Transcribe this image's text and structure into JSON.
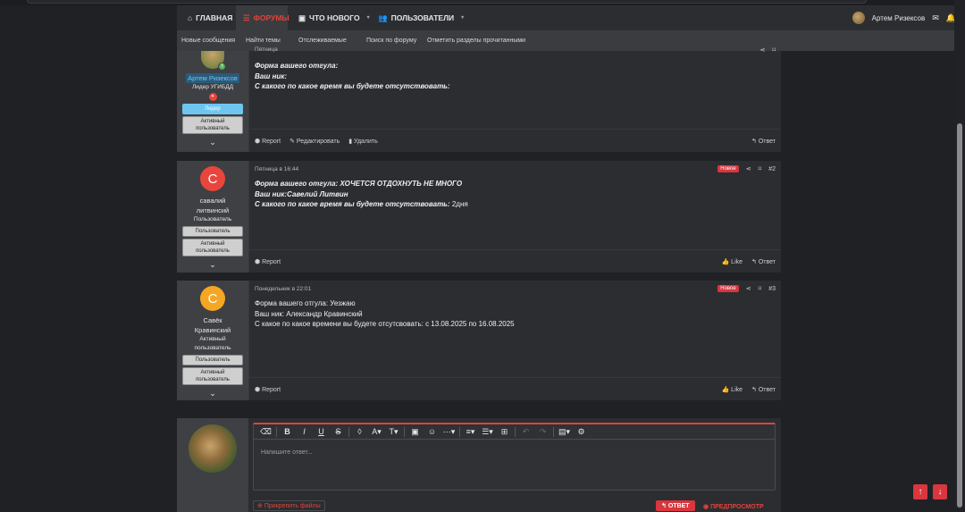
{
  "nav": {
    "items": [
      {
        "label": "ГЛАВНАЯ",
        "icon": "home-icon"
      },
      {
        "label": "ФОРУМЫ",
        "icon": "forum-icon"
      },
      {
        "label": "ЧТО НОВОГО",
        "icon": "news-icon"
      },
      {
        "label": "ПОЛЬЗОВАТЕЛИ",
        "icon": "users-icon"
      }
    ],
    "user_name": "Артем Ризексов",
    "accent_color": "#e0433a"
  },
  "subnav": {
    "items": [
      "Новые сообщения",
      "Найти темы",
      "Отслеживаемые",
      "Поиск по форуму",
      "Отметить разделы прочитанными"
    ]
  },
  "posts": [
    {
      "author": "Артем Ризексов",
      "author_title": "Лидер УГИБДД",
      "badges": [
        "Лидер",
        "Активный пользователь"
      ],
      "date": "Пятница",
      "lines": [
        {
          "label": "Форма вашего отгула:",
          "value": ""
        },
        {
          "label": "Ваш ник:",
          "value": ""
        },
        {
          "label": "С какого по какое время вы будете отсутствовать:",
          "value": ""
        }
      ],
      "footer_left": [
        "Report",
        "Редактировать",
        "Удалить"
      ],
      "footer_right": [
        "Ответ"
      ]
    },
    {
      "author_initial": "C",
      "author": "савалий литвинсий",
      "author_title": "Пользователь",
      "badges": [
        "Пользователь",
        "Активный пользователь"
      ],
      "date": "Пятница в 16:44",
      "new_badge": "Новое",
      "number": "#2",
      "lines": [
        {
          "label": "Форма вашего отгула: ХОЧЕТСЯ ОТДОХНУТЬ НЕ МНОГО",
          "value": ""
        },
        {
          "label": "Ваш ник:Савелий Литвин",
          "value": ""
        },
        {
          "label": "С какого по какое время вы будете отсутствовать:",
          "value": " 2дня"
        }
      ],
      "footer_left": [
        "Report"
      ],
      "footer_right": [
        "Like",
        "Ответ"
      ]
    },
    {
      "author_initial": "C",
      "author": "Савёк Кравинский",
      "author_title": "Активный пользователь",
      "badges": [
        "Пользователь",
        "Активный пользователь"
      ],
      "date": "Понедельник в 22:01",
      "new_badge": "Новое",
      "number": "#3",
      "lines": [
        {
          "label": "Форма вашего отгула: Уезжаю",
          "value": ""
        },
        {
          "label": "Ваш ник: Александр Кравинский",
          "value": ""
        },
        {
          "label": "С какое по какое времени вы будете отсутсвовать: с 13.08.2025 по 16.08.2025",
          "value": ""
        }
      ],
      "footer_left": [
        "Report"
      ],
      "footer_right": [
        "Like",
        "Ответ"
      ]
    }
  ],
  "reply": {
    "placeholder": "Напишите ответ...",
    "attach_label": "Прикрепить файлы",
    "submit_label": "ОТВЕТ",
    "preview_label": "ПРЕДПРОСМОТР"
  },
  "colors": {
    "avatar_c_red": "#e8453c",
    "avatar_c_orange": "#f5a623",
    "badge_leader": "#6ec6f0"
  }
}
